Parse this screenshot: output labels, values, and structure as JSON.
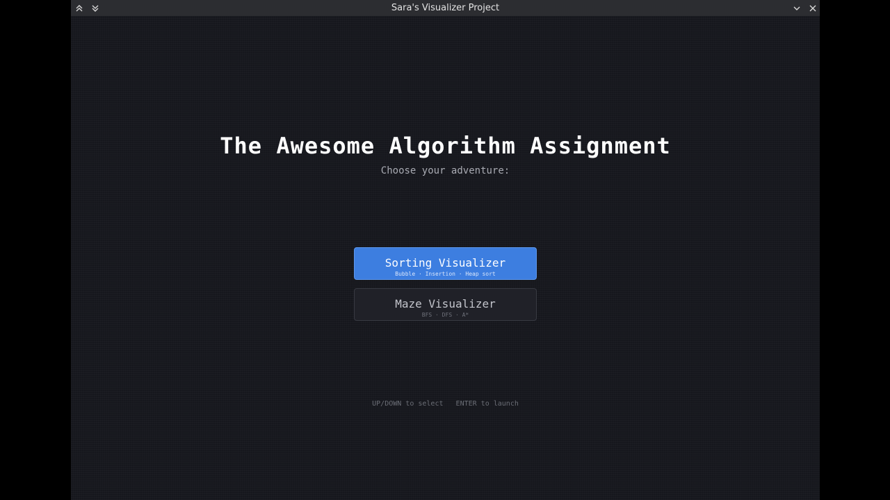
{
  "window": {
    "title": "Sara's Visualizer Project"
  },
  "menu": {
    "heading": "The Awesome Algorithm Assignment",
    "subtitle": "Choose your adventure:",
    "options": [
      {
        "title": "Sorting Visualizer",
        "subtitle": "Bubble · Insertion · Heap sort",
        "selected": true
      },
      {
        "title": "Maze Visualizer",
        "subtitle": "BFS · DFS · A*",
        "selected": false
      }
    ],
    "hint": "UP/DOWN to select   ENTER to launch"
  },
  "icons": {
    "titlebar_left": [
      "collapse-up-icon",
      "expand-down-icon"
    ],
    "titlebar_right": [
      "chevron-down-icon",
      "close-icon"
    ]
  },
  "colors": {
    "background": "#16171d",
    "titlebar": "#2c2d31",
    "accent": "#3d7ee0",
    "option_idle": "#202128"
  }
}
